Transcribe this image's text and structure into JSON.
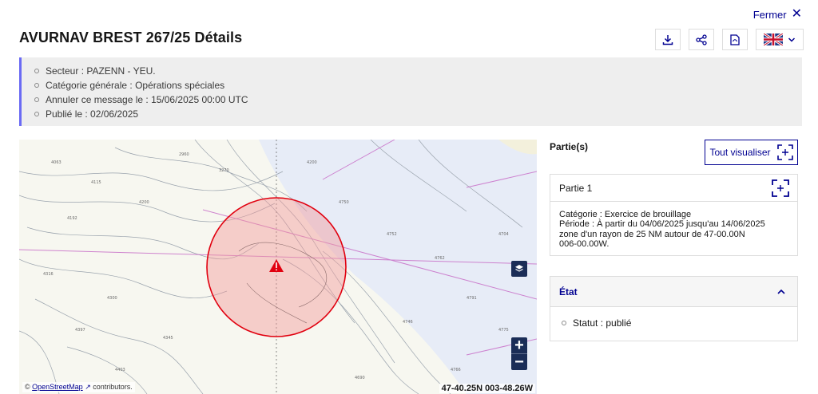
{
  "header": {
    "close_label": "Fermer",
    "title": "AVURNAV BREST 267/25 Détails",
    "toolbar": [
      {
        "icon": "download-icon"
      },
      {
        "icon": "share-icon"
      },
      {
        "icon": "pdf-icon"
      }
    ],
    "language_icon": "uk-flag-icon"
  },
  "summary": {
    "items": [
      "Secteur : PAZENN - YEU.",
      "Catégorie générale : Opérations spéciales",
      "Annuler ce message le : 15/06/2025 00:00 UTC",
      "Publié le : 02/06/2025"
    ]
  },
  "map": {
    "attribution_link": "OpenStreetMap",
    "attribution_suffix": "contributors.",
    "coordinates": "47-40.25N 003-48.26W",
    "zoom_in": "+",
    "zoom_out": "−",
    "zone_color": "#e1000f"
  },
  "parts": {
    "label": "Partie(s)",
    "view_all_label": "Tout visualiser",
    "items": [
      {
        "title": "Partie 1",
        "lines": [
          "Catégorie : Exercice de brouillage",
          "Période : À partir du 04/06/2025 jusqu'au 14/06/2025",
          "zone d'un rayon de 25 NM autour de 47-00.00N",
          "006-00.00W."
        ]
      }
    ]
  },
  "state": {
    "title": "État",
    "items": [
      "Statut : publié"
    ]
  },
  "colors": {
    "accent": "#000091",
    "summary_border": "#6a6af4",
    "map_button": "#1b2d57"
  }
}
